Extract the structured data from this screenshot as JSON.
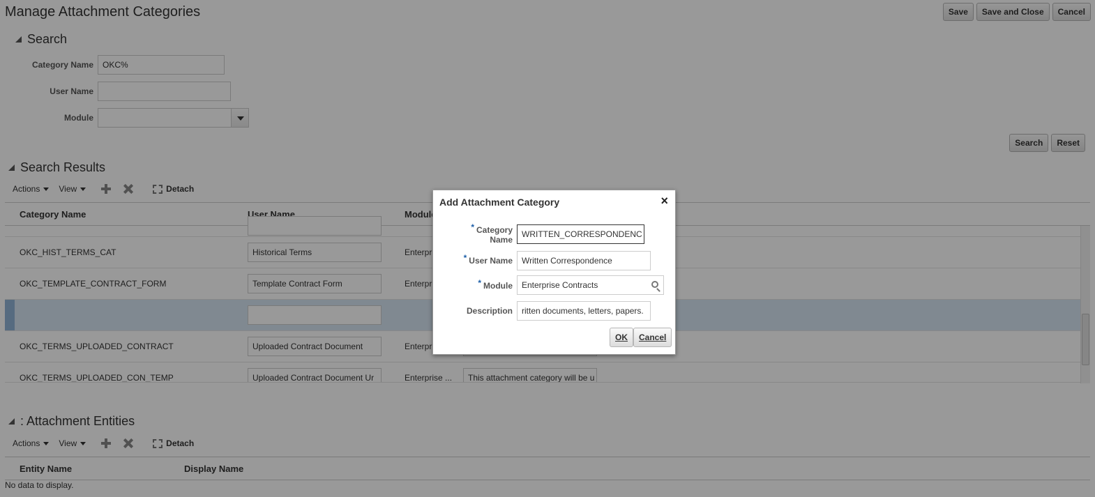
{
  "page": {
    "title": "Manage Attachment Categories"
  },
  "top_buttons": {
    "save": "Save",
    "save_close": "Save and Close",
    "cancel": "Cancel"
  },
  "search": {
    "title": "Search",
    "category_name_label": "Category Name",
    "category_name_value": "OKC%",
    "user_name_label": "User Name",
    "user_name_value": "",
    "module_label": "Module",
    "module_value": "",
    "search_button": "Search",
    "reset_button": "Reset"
  },
  "results": {
    "title": "Search Results",
    "toolbar": {
      "actions": "Actions",
      "view": "View",
      "detach": "Detach"
    },
    "columns": [
      "Category Name",
      "User Name",
      "Module"
    ],
    "rows": [
      {
        "category": "OKC_HIST_TERMS_CAT",
        "user_name": "Historical Terms",
        "module": "Enterprise",
        "description": ""
      },
      {
        "category": "OKC_TEMPLATE_CONTRACT_FORM",
        "user_name": "Template Contract Form",
        "module": "Enterpris",
        "description": ""
      },
      {
        "category": "",
        "user_name": "",
        "module": "",
        "description": ""
      },
      {
        "category": "OKC_TERMS_UPLOADED_CONTRACT",
        "user_name": "Uploaded Contract Document",
        "module": "Enterpris",
        "description": ""
      },
      {
        "category": "OKC_TERMS_UPLOADED_CON_TEMP",
        "user_name": "Uploaded Contract Document Ur",
        "module": "Enterprise ...",
        "description": "This attachment category will be u"
      }
    ]
  },
  "entities": {
    "title": ": Attachment Entities",
    "toolbar": {
      "actions": "Actions",
      "view": "View",
      "detach": "Detach"
    },
    "columns": [
      "Entity Name",
      "Display Name"
    ],
    "empty": "No data to display."
  },
  "dialog": {
    "title": "Add Attachment Category",
    "category_label_1": "Category",
    "category_label_2": "Name",
    "category_value": "WRITTEN_CORRESPONDENC",
    "user_name_label": "User Name",
    "user_name_value": "Written Correspondence",
    "module_label": "Module",
    "module_value": "Enterprise Contracts",
    "description_label": "Description",
    "description_value": "ritten documents, letters, papers.",
    "required_mark": "*",
    "ok_button": "OK",
    "cancel_button": "Cancel",
    "close_symbol": "×"
  },
  "icons": {
    "collapse": "disclosure-triangle-icon",
    "add": "plus-icon",
    "delete": "x-icon",
    "detach": "detach-icon",
    "search": "magnifier-icon",
    "close": "close-icon"
  }
}
